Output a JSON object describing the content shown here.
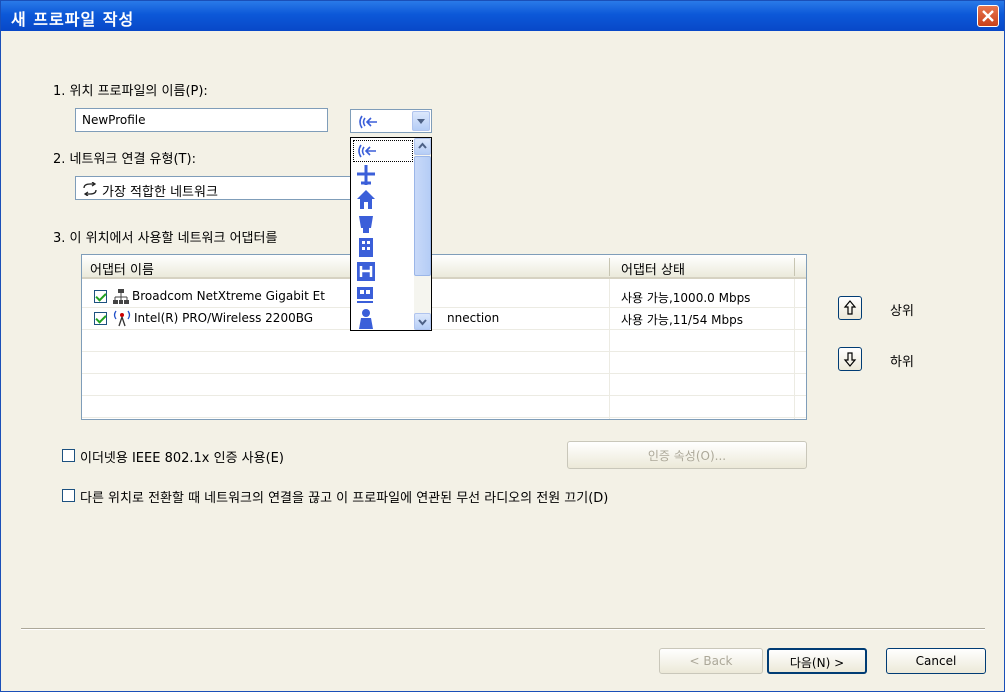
{
  "window": {
    "title": "새 프로파일 작성"
  },
  "profile_name": {
    "label": "1. 위치 프로파일의 이름(P):",
    "value": "NewProfile"
  },
  "network_type": {
    "label": "2. 네트워크 연결 유형(T):",
    "value": "가장 적합한 네트워크"
  },
  "icon_combo": {
    "selected_icon": "wireless-signal-icon"
  },
  "icon_dropdown": {
    "items": [
      "wireless-signal-icon",
      "airplane-icon",
      "house-icon",
      "coffee-cup-icon",
      "office-building-icon",
      "hotel-icon",
      "train-icon",
      "person-icon"
    ]
  },
  "adapters": {
    "label": "3. 이 위치에서 사용할 네트워크 어댑터를",
    "columns": [
      "어댑터 이름",
      "어댑터 상태"
    ],
    "rows": [
      {
        "checked": true,
        "icon": "wired-network-icon",
        "name": "Broadcom NetXtreme Gigabit Et",
        "status": "사용 가능,1000.0 Mbps"
      },
      {
        "checked": true,
        "icon": "wireless-antenna-icon",
        "name": "Intel(R) PRO/Wireless 2200BG",
        "name_tail": "nnection",
        "status": "사용 가능,11/54 Mbps"
      }
    ]
  },
  "move_up": {
    "label": "상위"
  },
  "move_down": {
    "label": "하위"
  },
  "ieee_option": {
    "label": "이더넷용 IEEE 802.1x 인증 사용(E)",
    "checked": false
  },
  "auth_button": {
    "label": "인증 속성(O)..."
  },
  "disconnect_option": {
    "label": "다른 위치로 전환할 때 네트워크의 연결을 끊고 이 프로파일에 연관된 무선 라디오의 전원 끄기(D)",
    "checked": false
  },
  "buttons": {
    "back": "< Back",
    "next": "다음(N) >",
    "cancel": "Cancel"
  },
  "colors": {
    "titlebar": "#0c58d8",
    "dialog_bg": "#f3f1e6",
    "icon_blue": "#3b5fd9"
  }
}
